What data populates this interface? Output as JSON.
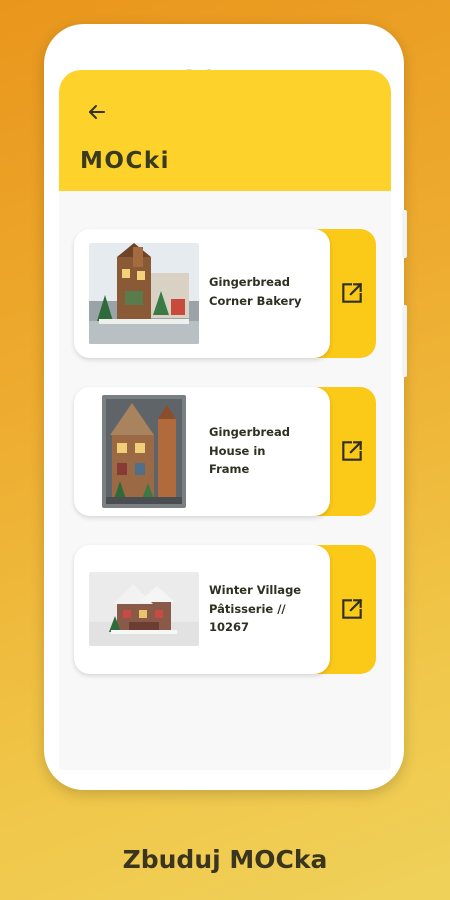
{
  "header": {
    "title": "MOCki",
    "back_icon": "arrow-left-icon"
  },
  "items": [
    {
      "title_lines": [
        "Gingerbread",
        "Corner Bakery"
      ],
      "image": "gingerbread-bakery-thumbnail",
      "action_icon": "open-in-new-icon"
    },
    {
      "title_lines": [
        "Gingerbread",
        "House in",
        "Frame"
      ],
      "image": "gingerbread-house-thumbnail",
      "action_icon": "open-in-new-icon"
    },
    {
      "title_lines": [
        "Winter Village",
        "Pâtisserie //",
        "10267"
      ],
      "image": "winter-village-patisserie-thumbnail",
      "action_icon": "open-in-new-icon"
    }
  ],
  "caption": "Zbuduj MOCka",
  "colors": {
    "accent": "#fdd22a",
    "tab": "#fbc917",
    "background": "#f8f8f8",
    "text": "#2f2f22"
  }
}
